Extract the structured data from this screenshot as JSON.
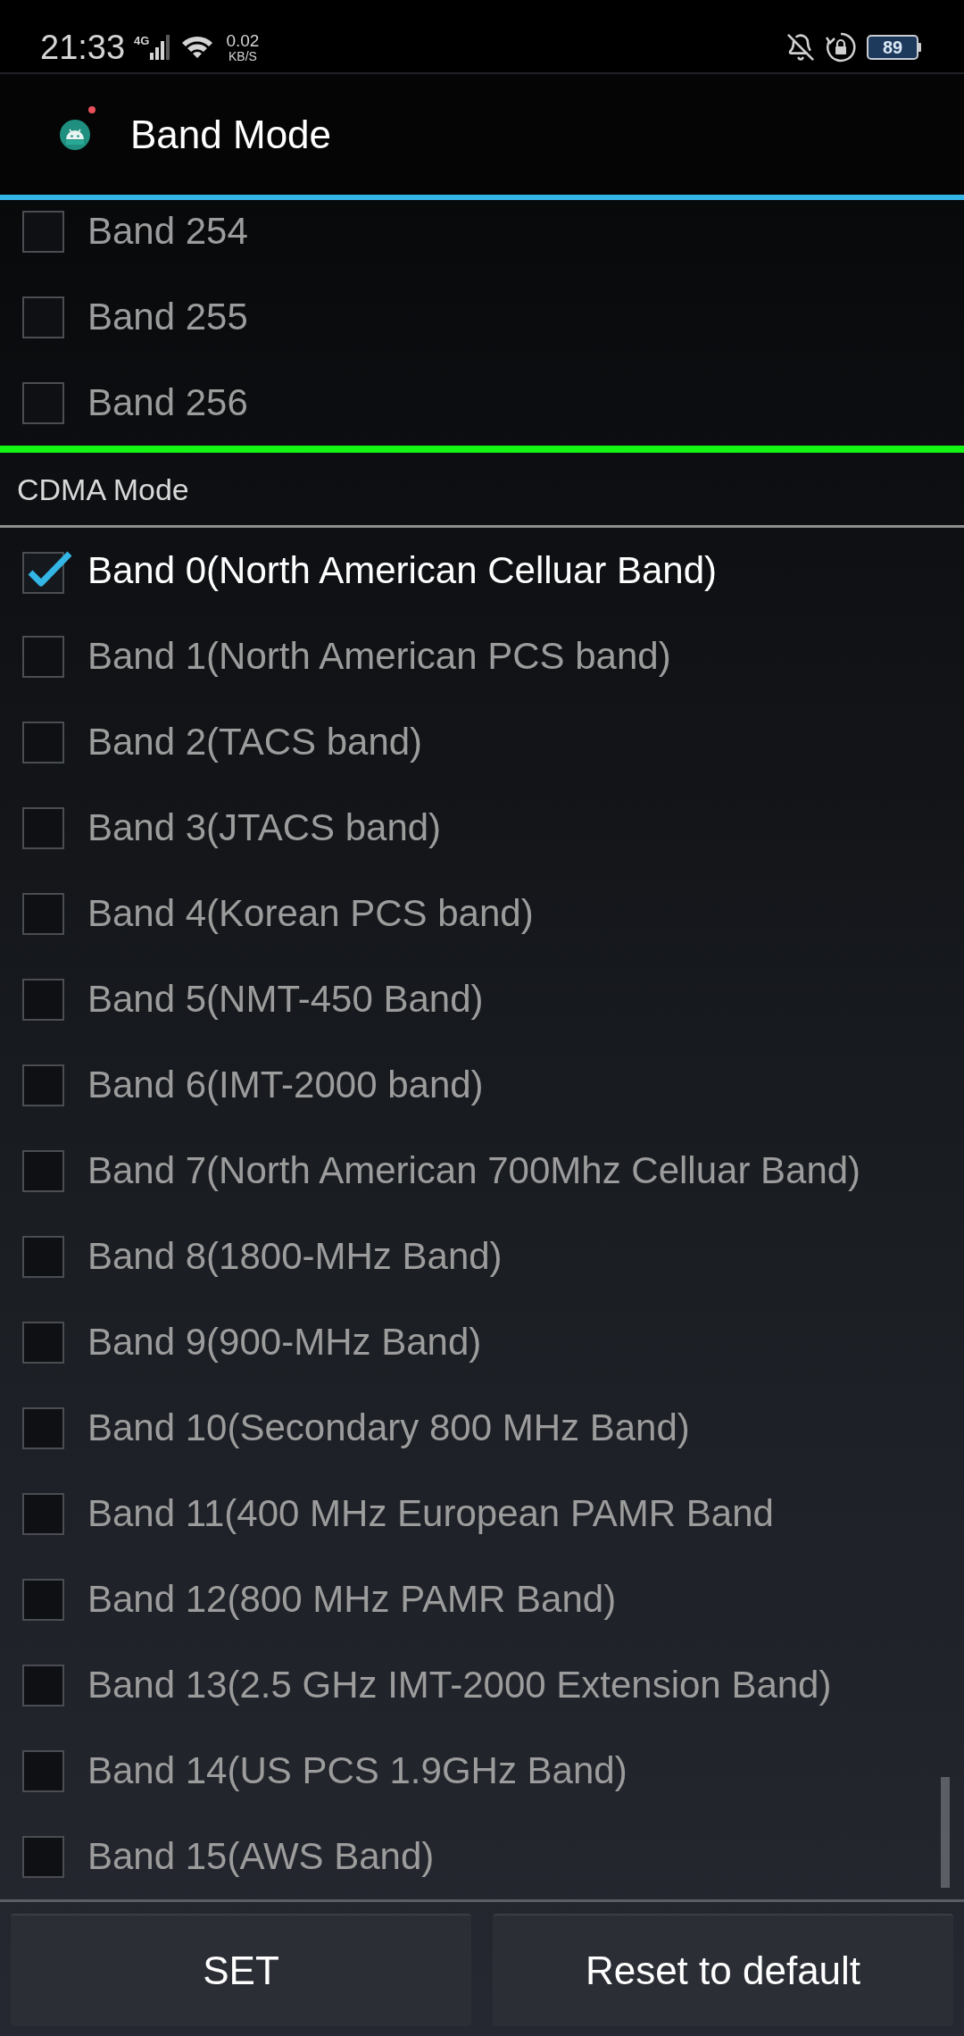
{
  "status_bar": {
    "time": "21:33",
    "network_type": "4G",
    "data_speed": "0.02",
    "data_speed_unit": "KB/S",
    "battery": "89"
  },
  "app_bar": {
    "title": "Band Mode"
  },
  "gsm_bands": [
    {
      "label": "Band 254",
      "checked": false
    },
    {
      "label": "Band 255",
      "checked": false
    },
    {
      "label": "Band 256",
      "checked": false
    }
  ],
  "cdma_section": {
    "title": "CDMA Mode",
    "bands": [
      {
        "label": "Band 0(North American Celluar Band)",
        "checked": true
      },
      {
        "label": "Band 1(North American PCS band)",
        "checked": false
      },
      {
        "label": "Band 2(TACS band)",
        "checked": false
      },
      {
        "label": "Band 3(JTACS band)",
        "checked": false
      },
      {
        "label": "Band 4(Korean PCS band)",
        "checked": false
      },
      {
        "label": "Band 5(NMT-450 Band)",
        "checked": false
      },
      {
        "label": "Band 6(IMT-2000 band)",
        "checked": false
      },
      {
        "label": "Band 7(North American 700Mhz Celluar Band)",
        "checked": false
      },
      {
        "label": "Band 8(1800-MHz Band)",
        "checked": false
      },
      {
        "label": "Band 9(900-MHz Band)",
        "checked": false
      },
      {
        "label": "Band 10(Secondary 800 MHz Band)",
        "checked": false
      },
      {
        "label": "Band 11(400 MHz European PAMR Band",
        "checked": false
      },
      {
        "label": "Band 12(800 MHz PAMR Band)",
        "checked": false
      },
      {
        "label": "Band 13(2.5 GHz IMT-2000 Extension Band)",
        "checked": false
      },
      {
        "label": "Band 14(US PCS 1.9GHz Band)",
        "checked": false
      },
      {
        "label": "Band 15(AWS Band)",
        "checked": false
      }
    ]
  },
  "buttons": [
    {
      "label": "SET"
    },
    {
      "label": "Reset to default"
    }
  ]
}
